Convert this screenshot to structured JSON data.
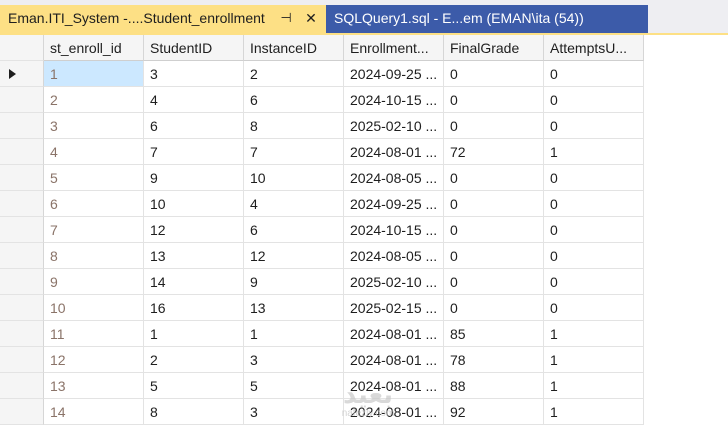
{
  "tabs": {
    "active": {
      "label": "Eman.ITI_System -....Student_enrollment",
      "pin_glyph": "⊣",
      "close_glyph": "✕"
    },
    "inactive": {
      "label": "SQLQuery1.sql - E...em (EMAN\\ita (54))"
    }
  },
  "grid": {
    "columns": [
      "st_enroll_id",
      "StudentID",
      "InstanceID",
      "Enrollment...",
      "FinalGrade",
      "AttemptsU..."
    ],
    "rows": [
      [
        "1",
        "3",
        "2",
        "2024-09-25 ...",
        "0",
        "0"
      ],
      [
        "2",
        "4",
        "6",
        "2024-10-15 ...",
        "0",
        "0"
      ],
      [
        "3",
        "6",
        "8",
        "2025-02-10 ...",
        "0",
        "0"
      ],
      [
        "4",
        "7",
        "7",
        "2024-08-01 ...",
        "72",
        "1"
      ],
      [
        "5",
        "9",
        "10",
        "2024-08-05 ...",
        "0",
        "0"
      ],
      [
        "6",
        "10",
        "4",
        "2024-09-25 ...",
        "0",
        "0"
      ],
      [
        "7",
        "12",
        "6",
        "2024-10-15 ...",
        "0",
        "0"
      ],
      [
        "8",
        "13",
        "12",
        "2024-08-05 ...",
        "0",
        "0"
      ],
      [
        "9",
        "14",
        "9",
        "2025-02-10 ...",
        "0",
        "0"
      ],
      [
        "10",
        "16",
        "13",
        "2025-02-15 ...",
        "0",
        "0"
      ],
      [
        "11",
        "1",
        "1",
        "2024-08-01 ...",
        "85",
        "1"
      ],
      [
        "12",
        "2",
        "3",
        "2024-08-01 ...",
        "78",
        "1"
      ],
      [
        "13",
        "5",
        "5",
        "2024-08-01 ...",
        "88",
        "1"
      ],
      [
        "14",
        "8",
        "3",
        "2024-08-01 ...",
        "92",
        "1"
      ]
    ],
    "selected_row": 0
  },
  "watermark": {
    "main": "بعيد",
    "sub": "nafezly.com"
  },
  "colors": {
    "active_tab": "#fde085",
    "inactive_tab": "#3c5ba9",
    "selected_cell": "#cce8ff",
    "id_text": "#8a7368"
  }
}
